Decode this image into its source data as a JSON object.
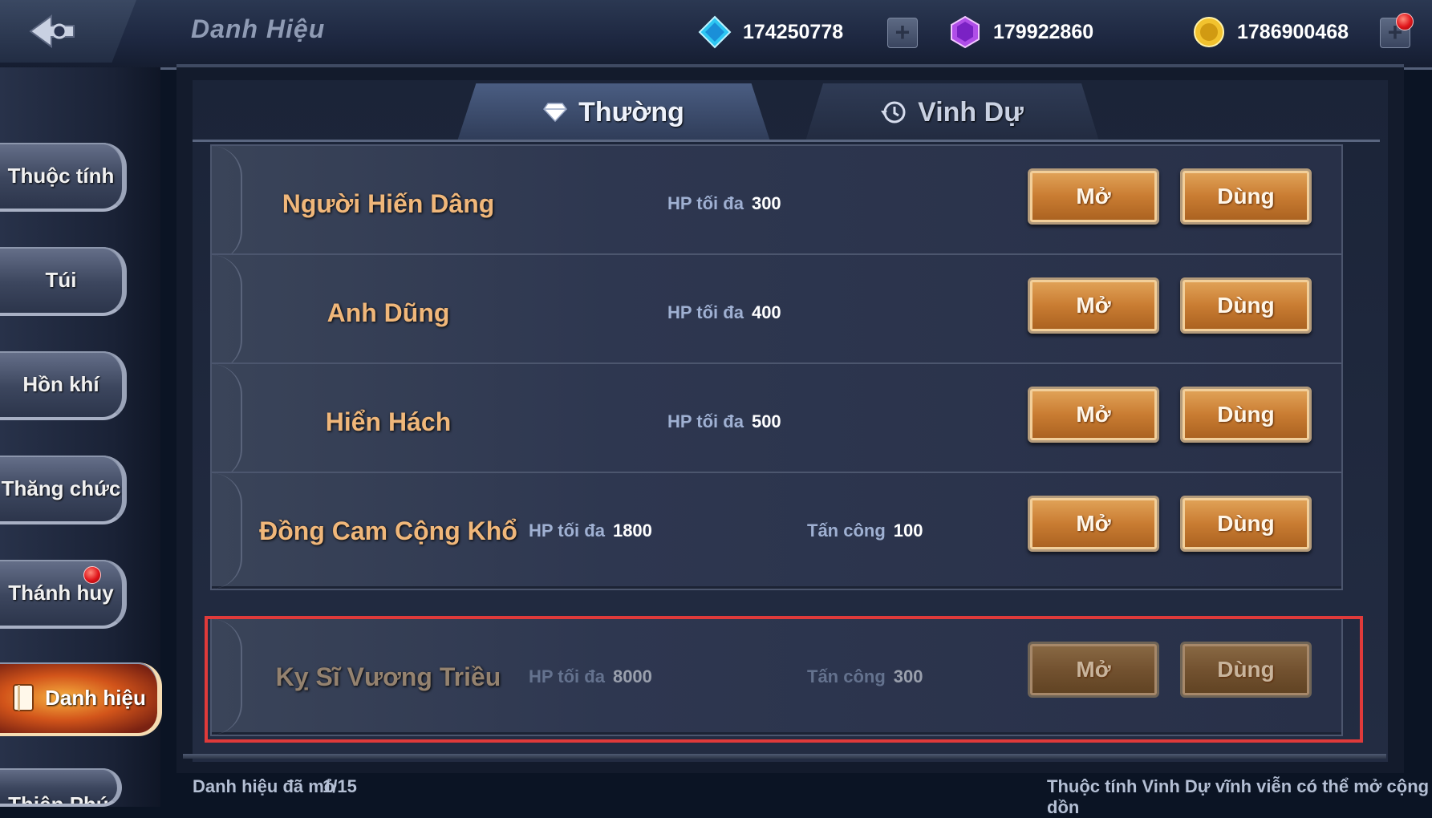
{
  "header": {
    "title": "Danh Hiệu",
    "resources": [
      {
        "icon": "diamond-icon",
        "amount": "174250778"
      },
      {
        "icon": "purple-gem-icon",
        "amount": "179922860"
      },
      {
        "icon": "gold-coin-icon",
        "amount": "1786900468"
      }
    ]
  },
  "nav": {
    "items": [
      {
        "label": "Thuộc tính"
      },
      {
        "label": "Túi"
      },
      {
        "label": "Hồn khí"
      },
      {
        "label": "Thăng chức"
      },
      {
        "label": "Thánh huy"
      },
      {
        "label": "Danh hiệu"
      },
      {
        "label": "Thiên Phú"
      }
    ],
    "active": "Danh hiệu"
  },
  "tabs": [
    {
      "label": "Thường"
    },
    {
      "label": "Vinh Dự"
    }
  ],
  "titles": [
    {
      "name": "Người Hiến Dâng",
      "stats": [
        {
          "label": "HP tối đa",
          "value": "300"
        }
      ],
      "open_label": "Mở",
      "use_label": "Dùng"
    },
    {
      "name": "Anh Dũng",
      "stats": [
        {
          "label": "HP tối đa",
          "value": "400"
        }
      ],
      "open_label": "Mở",
      "use_label": "Dùng"
    },
    {
      "name": "Hiển Hách",
      "stats": [
        {
          "label": "HP tối đa",
          "value": "500"
        }
      ],
      "open_label": "Mở",
      "use_label": "Dùng"
    },
    {
      "name": "Đồng Cam Cộng Khổ",
      "stats": [
        {
          "label": "HP tối đa",
          "value": "1800"
        },
        {
          "label": "Tấn công",
          "value": "100"
        }
      ],
      "open_label": "Mở",
      "use_label": "Dùng"
    },
    {
      "name": "Kỵ Sĩ Vương Triều",
      "stats": [
        {
          "label": "HP tối đa",
          "value": "8000"
        },
        {
          "label": "Tấn công",
          "value": "300"
        }
      ],
      "open_label": "Mở",
      "use_label": "Dùng"
    }
  ],
  "footer": {
    "unlocked_label": "Danh hiệu đã mở",
    "unlocked_count": "1/15",
    "note": "Thuộc tính Vinh Dự vĩnh viễn có thể mở cộng dồn"
  },
  "colors": {
    "highlight": "#e03a3a",
    "title_text": "#f0b77a",
    "button": "#c97c32"
  }
}
